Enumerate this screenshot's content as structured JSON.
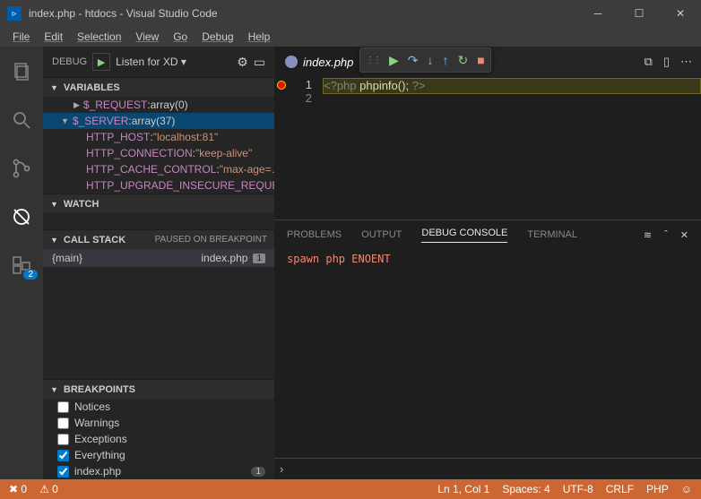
{
  "title": "index.php - htdocs - Visual Studio Code",
  "menu": [
    "File",
    "Edit",
    "Selection",
    "View",
    "Go",
    "Debug",
    "Help"
  ],
  "debug": {
    "label": "DEBUG",
    "config": "Listen for XD ▾",
    "sections": {
      "variables": "VARIABLES",
      "watch": "WATCH",
      "callstack": "CALL STACK",
      "callstack_status": "PAUSED ON BREAKPOINT",
      "breakpoints": "BREAKPOINTS"
    }
  },
  "variables": {
    "request": {
      "name": "$_REQUEST",
      "value": "array(0)"
    },
    "server": {
      "name": "$_SERVER",
      "value": "array(37)"
    },
    "host": {
      "name": "HTTP_HOST",
      "value": "\"localhost:81\""
    },
    "conn": {
      "name": "HTTP_CONNECTION",
      "value": "\"keep-alive\""
    },
    "cache": {
      "name": "HTTP_CACHE_CONTROL",
      "value": "\"max-age=…"
    },
    "upgrade": {
      "name": "HTTP_UPGRADE_INSECURE_REQUEST…",
      "value": ""
    }
  },
  "callstack": {
    "fn": "{main}",
    "file": "index.php",
    "line": "1"
  },
  "breakpoints": {
    "notices": {
      "label": "Notices",
      "checked": false
    },
    "warnings": {
      "label": "Warnings",
      "checked": false
    },
    "exceptions": {
      "label": "Exceptions",
      "checked": false
    },
    "everything": {
      "label": "Everything",
      "checked": true
    },
    "index": {
      "label": "index.php",
      "checked": true,
      "count": "1"
    }
  },
  "tab": {
    "name": "index.php"
  },
  "code": {
    "line1": {
      "num": "1",
      "open": "<?php",
      "call": " phpinfo",
      "paren": "(); ",
      "close": "?>"
    },
    "line2": {
      "num": "2"
    }
  },
  "panel": {
    "tabs": {
      "problems": "PROBLEMS",
      "output": "OUTPUT",
      "debug": "DEBUG CONSOLE",
      "terminal": "TERMINAL"
    },
    "message": "spawn php ENOENT",
    "prompt": "›"
  },
  "status": {
    "errors": "✖ 0",
    "warnings": "⚠ 0",
    "pos": "Ln 1, Col 1",
    "spaces": "Spaces: 4",
    "encoding": "UTF-8",
    "eol": "CRLF",
    "lang": "PHP",
    "feedback": "☺"
  },
  "activity_badge": "2"
}
